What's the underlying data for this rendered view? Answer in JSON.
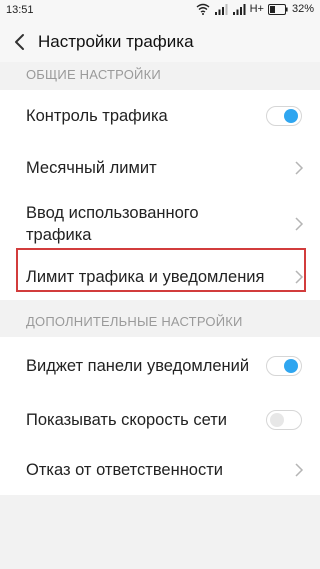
{
  "status_bar": {
    "time": "13:51",
    "network": "H+",
    "battery": "32%",
    "icons": [
      "wifi-icon",
      "signal-icon",
      "signal-icon",
      "battery-icon"
    ]
  },
  "header": {
    "title": "Настройки трафика",
    "back_icon": "chevron-left-icon"
  },
  "sections": {
    "general": {
      "title": "ОБЩИЕ НАСТРОЙКИ",
      "items": [
        {
          "label": "Контроль трафика",
          "control": "toggle",
          "state": "on"
        },
        {
          "label": "Месячный лимит",
          "control": "chevron"
        },
        {
          "label": "Ввод использованного трафика",
          "control": "chevron"
        },
        {
          "label": "Лимит трафика и уведомления",
          "control": "chevron",
          "highlighted": true
        }
      ]
    },
    "additional": {
      "title": "ДОПОЛНИТЕЛЬНЫЕ НАСТРОЙКИ",
      "items": [
        {
          "label": "Виджет панели уведомлений",
          "control": "toggle",
          "state": "on"
        },
        {
          "label": "Показывать скорость сети",
          "control": "toggle",
          "state": "off"
        },
        {
          "label": "Отказ от ответственности",
          "control": "chevron"
        }
      ]
    }
  },
  "colors": {
    "accent": "#2fa6f0",
    "highlight_border": "#d23c3c",
    "background": "#f2f2f2"
  }
}
